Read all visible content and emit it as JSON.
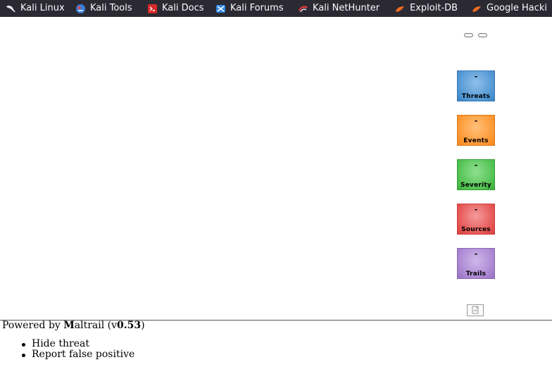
{
  "bookmarks": [
    {
      "label": "Kali Linux",
      "icon": "kali-dragon-icon"
    },
    {
      "label": "Kali Tools",
      "icon": "kali-tools-icon"
    },
    {
      "label": "Kali Docs",
      "icon": "kali-docs-icon"
    },
    {
      "label": "Kali Forums",
      "icon": "kali-forums-icon"
    },
    {
      "label": "Kali NetHunter",
      "icon": "kali-nethunter-icon"
    },
    {
      "label": "Exploit-DB",
      "icon": "exploit-db-icon"
    },
    {
      "label": "Google Hacki",
      "icon": "google-hacking-icon"
    }
  ],
  "tiles": {
    "threats": {
      "value": "-",
      "label": "Threats",
      "color": "#4d94d2"
    },
    "events": {
      "value": "-",
      "label": "Events",
      "color": "#ff962f"
    },
    "severity": {
      "value": "-",
      "label": "Severity",
      "color": "#4fc04f"
    },
    "sources": {
      "value": "-",
      "label": "Sources",
      "color": "#e65252"
    },
    "trails": {
      "value": "-",
      "label": "Trails",
      "color": "#a883d0"
    }
  },
  "footer": {
    "prefix": "Powered by ",
    "brand_initial": "M",
    "brand_rest": "altrail",
    "version_open": " (v",
    "version": "0.53",
    "version_close": ")"
  },
  "context_menu": {
    "items": [
      "Hide threat",
      "Report false positive"
    ]
  }
}
